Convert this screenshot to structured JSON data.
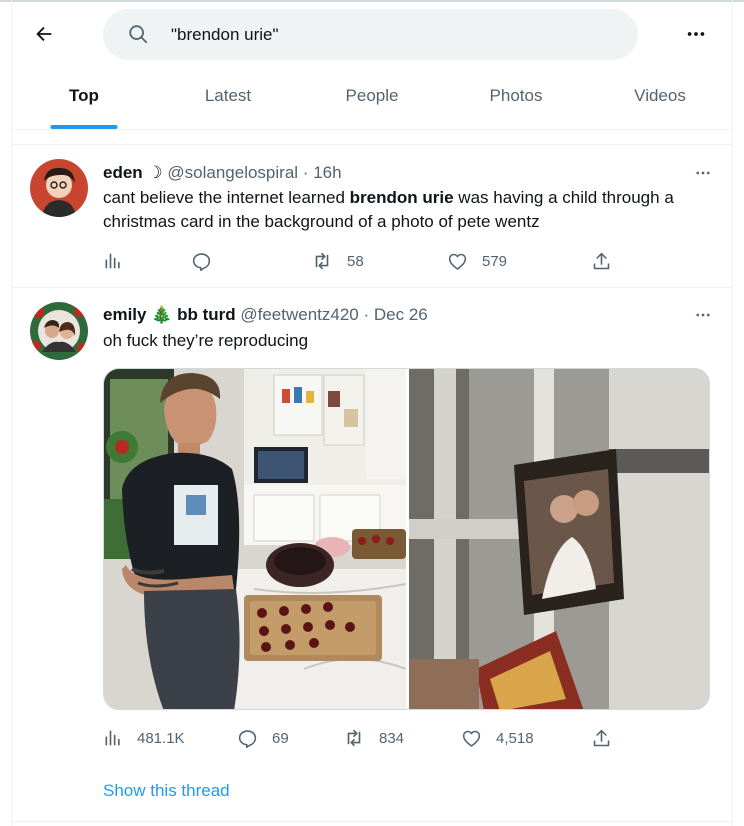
{
  "header": {
    "back_icon": "arrow-left-icon",
    "search": {
      "value": "\"brendon urie\"",
      "icon": "search-icon"
    },
    "more_icon": "more-horizontal-icon"
  },
  "tabs": [
    {
      "label": "Top",
      "active": true
    },
    {
      "label": "Latest",
      "active": false
    },
    {
      "label": "People",
      "active": false
    },
    {
      "label": "Photos",
      "active": false
    },
    {
      "label": "Videos",
      "active": false
    }
  ],
  "tweets": [
    {
      "display_name": "eden ☽",
      "handle": "@solangelospiral",
      "separator": "·",
      "time": "16h",
      "text_before": "cant believe the internet learned ",
      "text_bold": "brendon urie",
      "text_after": " was having a child through a christmas card in the background of a photo of pete wentz",
      "actions": {
        "views": "",
        "replies": "",
        "retweets": "58",
        "likes": "579"
      }
    },
    {
      "display_name": "emily 🎄 bb turd",
      "handle": "@feetwentz420",
      "separator": "·",
      "time": "Dec 26",
      "text": "oh fuck they’re reproducing",
      "actions": {
        "views": "481.1K",
        "replies": "69",
        "retweets": "834",
        "likes": "4,518"
      },
      "show_thread": "Show this thread"
    }
  ],
  "colors": {
    "accent": "#1d9bf0",
    "text_primary": "#0f1419",
    "text_secondary": "#536471",
    "border": "#eff3f4"
  }
}
